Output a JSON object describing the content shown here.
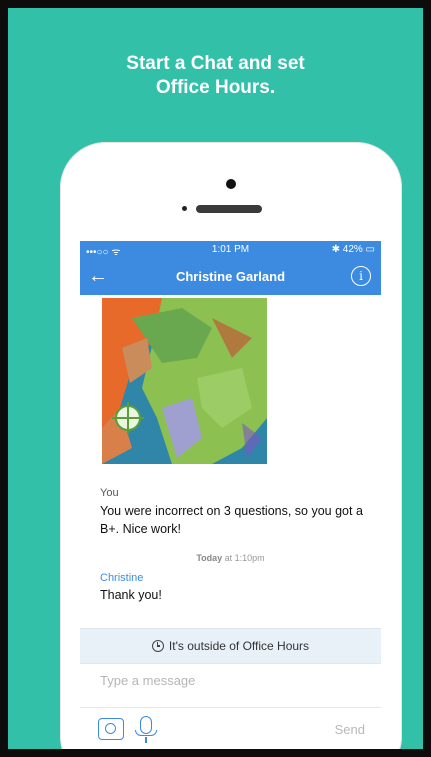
{
  "promo": {
    "headline_line1": "Start a Chat and set",
    "headline_line2": "Office Hours."
  },
  "status_bar": {
    "signal": "•••○○ ᯤ",
    "time": "1:01 PM",
    "battery": "✱ 42% ▭"
  },
  "nav": {
    "back_icon": "←",
    "title": "Christine Garland",
    "info_icon": "i"
  },
  "messages": [
    {
      "sender": "You",
      "text": "You were incorrect on 3 questions, so you got a B+. Nice work!"
    },
    {
      "sender": "Christine",
      "text": "Thank you!"
    }
  ],
  "timestamp": {
    "day": "Today",
    "time": " at 1:10pm"
  },
  "office_hours_notice": "It's outside of Office Hours",
  "composer": {
    "placeholder": "Type a message",
    "send_label": "Send"
  },
  "colors": {
    "background": "#33c0a9",
    "accent": "#3d8be0"
  },
  "icons": [
    "camera-icon",
    "microphone-icon",
    "clock-icon",
    "back-arrow-icon",
    "info-icon"
  ]
}
